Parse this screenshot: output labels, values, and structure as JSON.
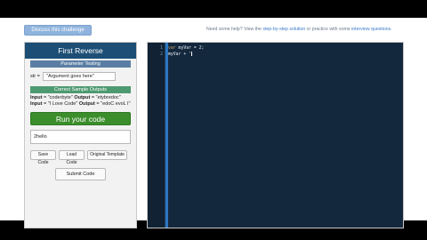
{
  "discuss_button": "Discuss this challenge",
  "help": {
    "prefix": "Need some help? View the ",
    "step_link": "step-by-step solution",
    "middle": " or practice with some ",
    "interview_link": "interview questions",
    "suffix": "."
  },
  "panel": {
    "title": "First Reverse",
    "param_header": "Parameter Testing",
    "param_label": "str =",
    "param_value": "\"Argument goes here\"",
    "samples_header": "Correct Sample Outputs",
    "samples": [
      {
        "input_label": "Input",
        "input": "\"coderbyte\"",
        "output_label": "Output",
        "output": "\"etybredoc\""
      },
      {
        "input_label": "Input",
        "input": "\"I Love Code\"",
        "output_label": "Output",
        "output": "\"edoC evoL I\""
      }
    ],
    "run_button": "Run your code",
    "output_value": "2hello",
    "buttons": {
      "save": "Save Code",
      "load": "Load Code",
      "template": "Original Template"
    },
    "submit_button": "Submit Code"
  },
  "editor": {
    "lines": [
      {
        "num": "1",
        "keyword": "var",
        "rest": " myVar = 2;"
      },
      {
        "num": "2",
        "keyword": "",
        "rest": "myVar + '"
      }
    ]
  }
}
